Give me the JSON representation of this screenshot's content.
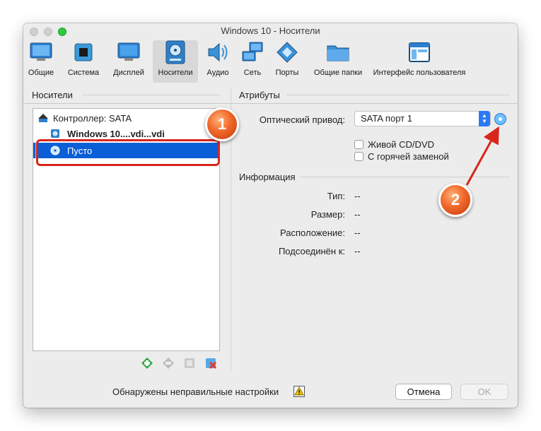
{
  "window": {
    "title": "Windows 10    - Носители"
  },
  "toolbar": {
    "items": [
      {
        "label": "Общие",
        "icon": "monitor-icon"
      },
      {
        "label": "Система",
        "icon": "chip-icon"
      },
      {
        "label": "Дисплей",
        "icon": "display-icon"
      },
      {
        "label": "Носители",
        "icon": "storage-icon",
        "active": true
      },
      {
        "label": "Аудио",
        "icon": "speaker-icon"
      },
      {
        "label": "Сеть",
        "icon": "network-icon"
      },
      {
        "label": "Порты",
        "icon": "port-icon"
      },
      {
        "label": "Общие папки",
        "icon": "folder-icon"
      },
      {
        "label": "Интерфейс пользователя",
        "icon": "ui-window-icon"
      }
    ]
  },
  "storage": {
    "section_title": "Носители",
    "tree": {
      "controller": "Контроллер: SATA",
      "disk": "Windows 10....vdi...vdi",
      "empty": "Пусто"
    }
  },
  "attributes": {
    "section_title": "Атрибуты",
    "optical_drive_label": "Оптический привод:",
    "optical_drive_value": "SATA порт 1",
    "live_cd": "Живой CD/DVD",
    "hot_swap": "С горячей заменой"
  },
  "information": {
    "section_title": "Информация",
    "rows": [
      {
        "label": "Тип:",
        "value": "--"
      },
      {
        "label": "Размер:",
        "value": "--"
      },
      {
        "label": "Расположение:",
        "value": "--"
      },
      {
        "label": "Подсоединён к:",
        "value": "--"
      }
    ]
  },
  "footer": {
    "warning_text": "Обнаружены неправильные настройки",
    "cancel": "Отмена",
    "ok": "OK"
  },
  "annotations": {
    "badge1": "1",
    "badge2": "2",
    "color": "#d9261c"
  }
}
